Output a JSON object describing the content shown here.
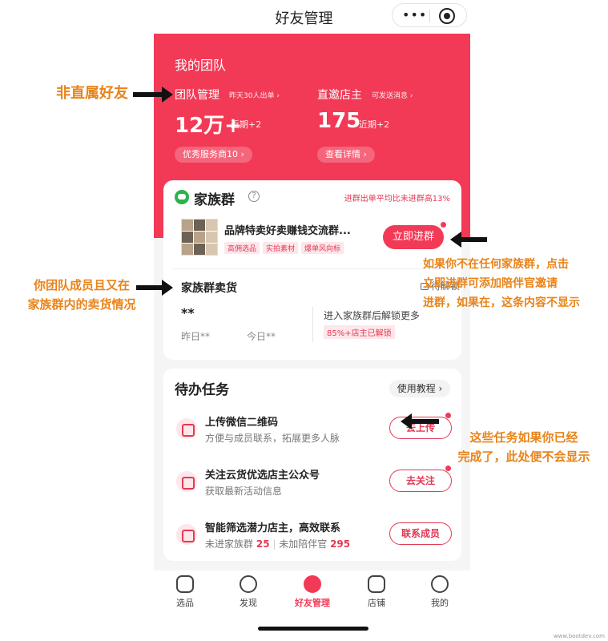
{
  "nav": {
    "title": "好友管理",
    "menu_dots": "•••"
  },
  "team": {
    "title": "我的团队",
    "stats": [
      {
        "name": "团队管理",
        "sub": "昨天30人出单 ›",
        "value": "12万+",
        "recent": "近期+2",
        "pill": "优秀服务商10 ›"
      },
      {
        "name": "直邀店主",
        "sub": "可发送消息 ›",
        "value": "175",
        "recent": "近期+2",
        "pill": "查看详情 ›"
      }
    ]
  },
  "family": {
    "title": "家族群",
    "help": "?",
    "note": "进群出单平均比未进群高13%",
    "group_name": "品牌特卖好卖赚钱交流群...",
    "tags": [
      "高佣选品",
      "实拍素材",
      "爆单风向标"
    ],
    "join_button": "立即进群",
    "sales_title": "家族群卖货",
    "lock_text": "待解锁",
    "masked_value": "**",
    "yesterday": "昨日**",
    "today": "今日**",
    "unlock_text": "进入家族群后解锁更多",
    "unlock_badge": "85%+店主已解锁"
  },
  "todo": {
    "title": "待办任务",
    "tutorial": "使用教程 ›",
    "tasks": [
      {
        "name": "上传微信二维码",
        "desc": "方便与成员联系，拓展更多人脉",
        "button": "去上传",
        "icon": "qrcode-icon"
      },
      {
        "name": "关注云货优选店主公众号",
        "desc": "获取最新活动信息",
        "button": "去关注",
        "icon": "follow-icon"
      },
      {
        "name": "智能筛选潜力店主，高效联系",
        "desc_a": "未进家族群",
        "count_a": "25",
        "desc_b": "未加陪伴官",
        "count_b": "295",
        "button": "联系成员",
        "icon": "chat-icon"
      }
    ]
  },
  "tabs": [
    {
      "label": "选品",
      "icon": "search-icon"
    },
    {
      "label": "发现",
      "icon": "compass-icon"
    },
    {
      "label": "好友管理",
      "icon": "friends-icon"
    },
    {
      "label": "店铺",
      "icon": "shop-icon"
    },
    {
      "label": "我的",
      "icon": "profile-icon"
    }
  ],
  "annotations": {
    "a1": "非直属好友",
    "a2_line1": "你团队成员且又在",
    "a2_line2": "家族群内的卖货情况",
    "a3_line1": "如果你不在任何家族群，点击",
    "a3_line2": "立即进群可添加陪伴官邀请",
    "a3_line3": "进群，如果在，这条内容不显示",
    "a4_line1": "这些任务如果你已经",
    "a4_line2": "完成了，此处便不会显示"
  },
  "watermark": "www.bootdev.com"
}
